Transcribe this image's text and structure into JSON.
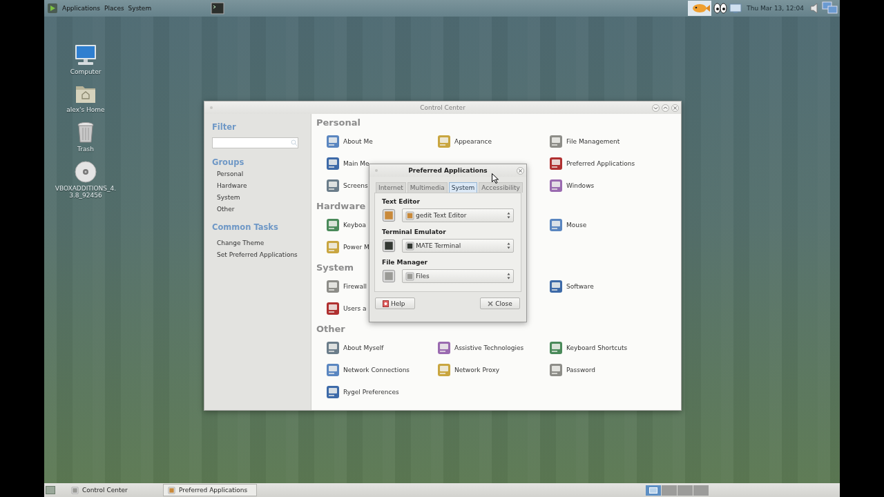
{
  "top_panel": {
    "menus": [
      "Applications",
      "Places",
      "System"
    ],
    "clock": "Thu Mar 13, 12:04"
  },
  "desktop_icons": [
    {
      "kind": "computer",
      "label": "Computer"
    },
    {
      "kind": "folder",
      "label": "alex's Home"
    },
    {
      "kind": "trash",
      "label": "Trash"
    },
    {
      "kind": "disc",
      "label": "VBOXADDITIONS_4.\n3.8_92456"
    }
  ],
  "control_center": {
    "title": "Control Center",
    "filter": {
      "heading": "Filter"
    },
    "groups": {
      "heading": "Groups",
      "items": [
        "Personal",
        "Hardware",
        "System",
        "Other"
      ]
    },
    "common_tasks": {
      "heading": "Common Tasks",
      "items": [
        "Change Theme",
        "Set Preferred Applications"
      ]
    },
    "sections": [
      {
        "title": "Personal",
        "rows": [
          {
            "col_1": "About Me",
            "col_2": "Appearance",
            "col_3": "File Management"
          },
          {
            "col_1": "Main Me",
            "col_3": "Preferred Applications"
          },
          {
            "col_1": "Screens",
            "col_3": "Windows"
          }
        ]
      },
      {
        "title": "Hardware",
        "rows": [
          {
            "col_1": "Keyboa",
            "col_3": "Mouse"
          },
          {
            "col_1": "Power M"
          }
        ]
      },
      {
        "title": "System",
        "rows": [
          {
            "col_1": "Firewall",
            "col_3": "Software"
          },
          {
            "col_1": "Users a"
          }
        ]
      },
      {
        "title": "Other",
        "rows": [
          {
            "col_1": "About Myself",
            "col_2": "Assistive Technologies",
            "col_3": "Keyboard Shortcuts"
          },
          {
            "col_1": "Network Connections",
            "col_2": "Network Proxy",
            "col_3": "Password"
          },
          {
            "col_1": "Rygel Preferences"
          }
        ]
      }
    ]
  },
  "dialog": {
    "title": "Preferred Applications",
    "tabs": [
      {
        "label": "Internet",
        "selected": false
      },
      {
        "label": "Multimedia",
        "selected": false
      },
      {
        "label": "System",
        "selected": true
      },
      {
        "label": "Accessibility",
        "selected": false
      }
    ],
    "groups": [
      {
        "label": "Text Editor",
        "value": "gedit Text Editor"
      },
      {
        "label": "Terminal Emulator",
        "value": "MATE Terminal"
      },
      {
        "label": "File Manager",
        "value": "Files"
      }
    ],
    "buttons": [
      {
        "kind": "help",
        "label": "Help"
      },
      {
        "kind": "close",
        "label": "Close"
      }
    ]
  },
  "taskbar": {
    "windows": [
      {
        "label": "Control Center",
        "selected": false
      },
      {
        "label": "Preferred Applications",
        "selected": true
      }
    ],
    "workspaces": [
      {
        "selected": true
      },
      {
        "selected": false
      },
      {
        "selected": false
      },
      {
        "selected": false
      }
    ]
  }
}
